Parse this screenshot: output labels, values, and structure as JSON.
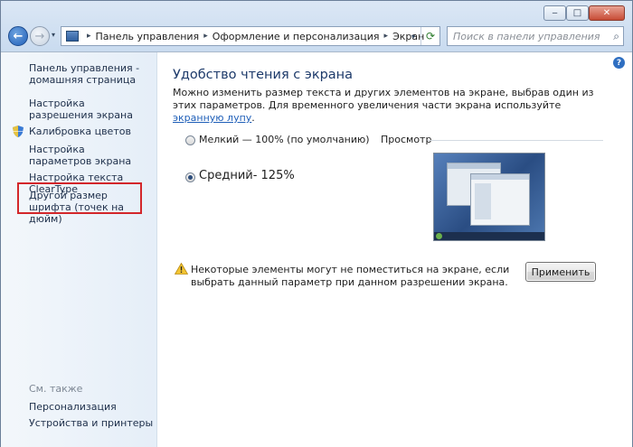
{
  "window": {
    "caption": {
      "minimize": "‒",
      "maximize": "□",
      "close": "✕"
    }
  },
  "nav": {
    "back": "←",
    "forward": "→",
    "history": "▾",
    "address": {
      "separator": "▸",
      "crumbs": [
        "Панель управления",
        "Оформление и персонализация",
        "Экран"
      ],
      "dropdown": "▾",
      "refresh": "⟳"
    },
    "search": {
      "placeholder": "Поиск в панели управления",
      "icon": "⌕"
    }
  },
  "sidebar": {
    "home": "Панель управления - домашняя страница",
    "links": [
      "Настройка разрешения экрана",
      "Калибровка цветов",
      "Настройка параметров экрана",
      "Настройка текста ClearType",
      "Другой размер шрифта (точек на дюйм)"
    ],
    "see_also": "См. также",
    "see_also_links": [
      "Персонализация",
      "Устройства и принтеры"
    ]
  },
  "main": {
    "title": "Удобство чтения с экрана",
    "description": "Можно изменить размер текста и других элементов на экране, выбрав один из этих параметров. Для временного увеличения части экрана используйте",
    "magnifier_link": "экранную лупу",
    "description_end": ".",
    "options": [
      {
        "label": "Мелкий — 100% (по умолчанию)",
        "selected": false
      },
      {
        "label": "Средний- 125%",
        "selected": true
      }
    ],
    "preview_label": "Просмотр",
    "warning": "Некоторые элементы могут не поместиться на экране, если выбрать данный параметр при данном разрешении экрана.",
    "apply_button": "Применить",
    "help": "?"
  },
  "colors": {
    "accent": "#1f5fb8",
    "highlight_border": "#d3262a",
    "title": "#1d3a6a"
  }
}
